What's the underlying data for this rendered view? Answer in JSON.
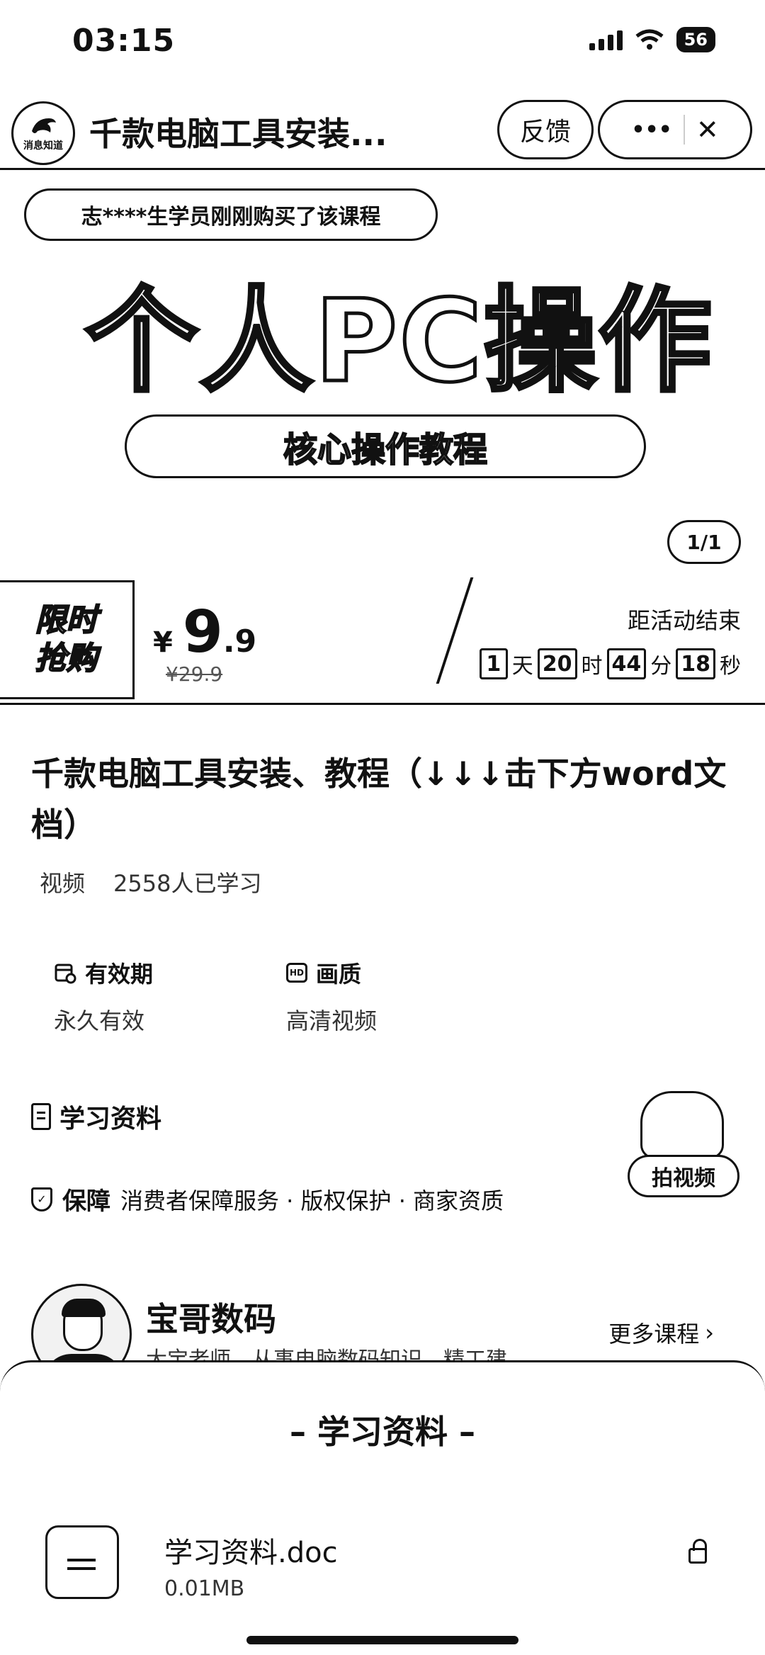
{
  "status_bar": {
    "time": "03:15",
    "battery": "56"
  },
  "header": {
    "logo_text": "消息知道",
    "title": "千款电脑工具安装...",
    "feedback_label": "反馈",
    "more_label": "•••",
    "close_label": "✕"
  },
  "banner": {
    "buyer_tip": "志****生学员刚刚购买了该课程",
    "title": "个人PC操作",
    "subtitle": "核心操作教程",
    "page_indicator": "1/1"
  },
  "promo": {
    "tag_line1": "限时",
    "tag_line2": "抢购",
    "currency": "¥",
    "price_int": "9",
    "price_dec": ".9",
    "original_price": "¥29.9",
    "countdown_label": "距活动结束",
    "countdown": {
      "days": "1",
      "days_unit": "天",
      "hours": "20",
      "hours_unit": "时",
      "minutes": "44",
      "minutes_unit": "分",
      "seconds": "18",
      "seconds_unit": "秒"
    }
  },
  "course": {
    "title": "千款电脑工具安装、教程（↓↓↓击下方word文档）",
    "type": "视频",
    "learners": "2558人已学习",
    "validity_label": "有效期",
    "validity_value": "永久有效",
    "quality_label": "画质",
    "quality_icon": "HD",
    "quality_value": "高清视频",
    "materials_label": "学习资料",
    "guarantee_label": "保障",
    "guarantee_items": "消费者保障服务 · 版权保护 · 商家资质",
    "float_video_label": "拍视频"
  },
  "author": {
    "name": "宝哥数码",
    "desc": "大宝老师，从事电脑数码知识，精工建",
    "more_label": "更多课程"
  },
  "sheet": {
    "title": "– 学习资料 –",
    "file_name": "学习资料.doc",
    "file_size": "0.01MB"
  }
}
